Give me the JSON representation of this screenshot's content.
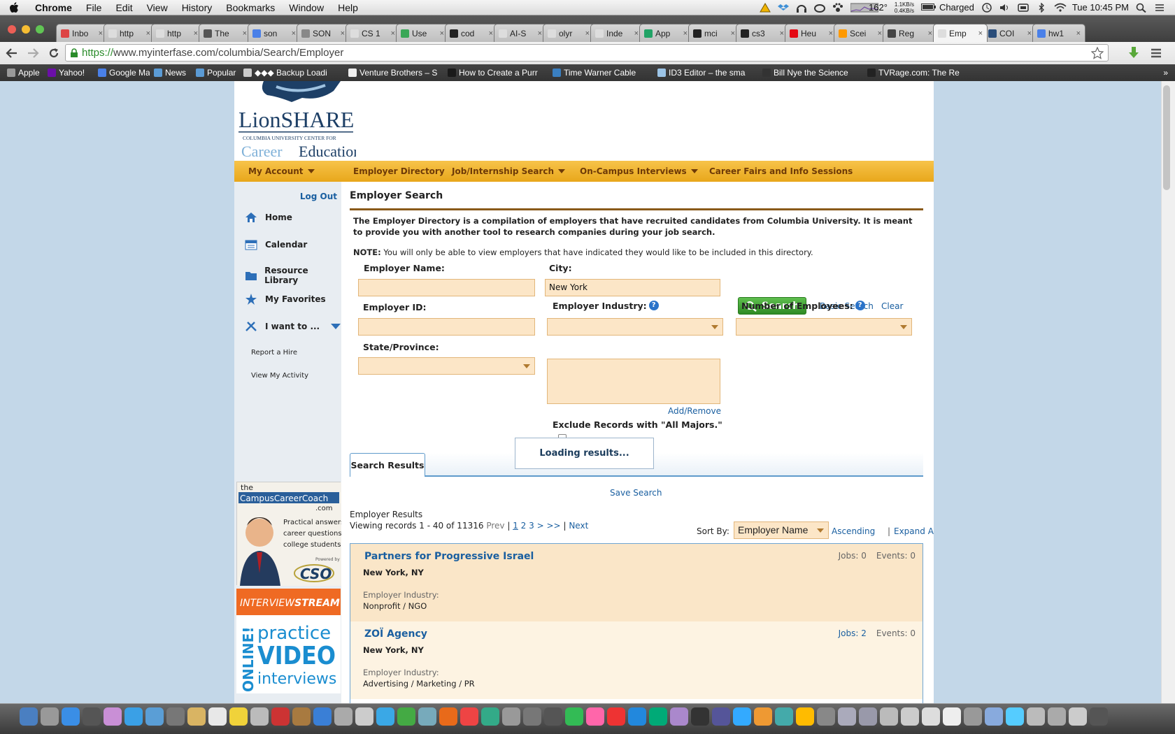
{
  "menubar": {
    "items": [
      "Chrome",
      "File",
      "Edit",
      "View",
      "History",
      "Bookmarks",
      "Window",
      "Help"
    ],
    "temperature": "162°",
    "net_up": "1.1KB/s",
    "net_down": "0.4KB/s",
    "battery": "Charged",
    "clock": "Tue 10:45 PM"
  },
  "tabs": [
    {
      "title": "Inbo",
      "color": "#d44"
    },
    {
      "title": "http",
      "color": "#ddd"
    },
    {
      "title": "http",
      "color": "#ddd"
    },
    {
      "title": "The",
      "color": "#555"
    },
    {
      "title": "son",
      "color": "#4a80e8"
    },
    {
      "title": "SON",
      "color": "#888"
    },
    {
      "title": "CS 1",
      "color": "#ddd"
    },
    {
      "title": "Use",
      "color": "#3aa757"
    },
    {
      "title": "cod",
      "color": "#222"
    },
    {
      "title": "AI-S",
      "color": "#ddd"
    },
    {
      "title": "olyr",
      "color": "#ddd"
    },
    {
      "title": "Inde",
      "color": "#ddd"
    },
    {
      "title": "App",
      "color": "#21a366"
    },
    {
      "title": "mci",
      "color": "#222"
    },
    {
      "title": "cs3",
      "color": "#222"
    },
    {
      "title": "Heu",
      "color": "#e50914"
    },
    {
      "title": "Scei",
      "color": "#f90"
    },
    {
      "title": "Reg",
      "color": "#444"
    },
    {
      "title": "Emp",
      "color": "#ddd"
    },
    {
      "title": "COI",
      "color": "#2a4d7a"
    },
    {
      "title": "hw1",
      "color": "#4a80e8"
    }
  ],
  "address": {
    "scheme": "https://",
    "rest": "www.myinterfase.com/columbia/Search/Employer"
  },
  "bookmarks": [
    {
      "label": "Apple",
      "color": "#999"
    },
    {
      "label": "Yahoo!",
      "color": "#6b0fa8"
    },
    {
      "label": "Google Maps",
      "color": "#4a80e8"
    },
    {
      "label": "News",
      "color": "#5b9bd5"
    },
    {
      "label": "Popular",
      "color": "#5b9bd5"
    },
    {
      "label": "◆◆◆ Backup Loadi",
      "color": "#ccc"
    },
    {
      "label": "Venture Brothers – S",
      "color": "#eee"
    },
    {
      "label": "How to Create a Purr",
      "color": "#1a1a1a"
    },
    {
      "label": "Time Warner Cable",
      "color": "#3a7fc1"
    },
    {
      "label": "ID3 Editor – the sma",
      "color": "#9cc4e6"
    },
    {
      "label": "Bill Nye the Science",
      "color": "#333"
    },
    {
      "label": "TVRage.com: The Re",
      "color": "#222"
    }
  ],
  "site": {
    "logo_line1": "LionSHARE",
    "logo_line2": "COLUMBIA UNIVERSITY CENTER FOR",
    "logo_career": "Career",
    "logo_education": "Education"
  },
  "nav": {
    "my_account": "My Account",
    "employer_directory": "Employer Directory",
    "job_search": "Job/Internship Search",
    "on_campus": "On-Campus Interviews",
    "career_fairs": "Career Fairs and Info Sessions"
  },
  "sidebar": {
    "logout": "Log Out",
    "items": [
      "Home",
      "Calendar",
      "Resource Library",
      "My Favorites",
      "I want to ..."
    ],
    "subitems": [
      "Report a Hire",
      "View My Activity"
    ],
    "ad1": {
      "the": "the",
      "brand": "CampusCareerCoach",
      "com": ".com",
      "tagline1": "Practical answers to",
      "tagline2": "career questions for",
      "tagline3": "college students.",
      "powered": "Powered by",
      "cso": "CSO"
    },
    "ad2": {
      "interview": "INTERVIEW",
      "stream": "STREAM",
      "online": "ONLINE!",
      "practice": "practice",
      "video": "VIDEO",
      "interviews": "interviews"
    }
  },
  "main": {
    "title": "Employer Search",
    "intro": "The Employer Directory is a compilation of employers that have recruited candidates from Columbia University.  It is meant to provide you with another tool to research companies during your job search.",
    "note_label": "NOTE:",
    "note_text": " You will only be able to view employers that have indicated they would like to be included in this directory.",
    "form": {
      "employer_name_label": "Employer Name:",
      "employer_name_value": "",
      "city_label": "City:",
      "city_value": "New York",
      "search_button": "Search",
      "basic_search": "Basic Search",
      "clear": "Clear",
      "employer_id_label": "Employer ID:",
      "industry_label": "Employer Industry:",
      "num_employees_label": "Number of Employees:",
      "state_label": "State/Province:",
      "add_remove": "Add/Remove",
      "exclude_label": "Exclude Records with \"All Majors.\"",
      "help_glyph": "?"
    },
    "loading": "Loading results...",
    "results_tab": "Search Results",
    "save_search": "Save Search",
    "results_heading": "Employer Results",
    "viewing": "Viewing records 1 - 40 of 11316",
    "prev": "Prev",
    "pages": [
      "1",
      "2",
      "3",
      ">",
      ">>"
    ],
    "next": "Next",
    "sort_by_label": "Sort By:",
    "sort_value": "Employer Name",
    "ascending": "Ascending",
    "expand_all": "Expand All",
    "separator": "|",
    "results": [
      {
        "name": "Partners for Progressive Israel",
        "city": "New York, NY",
        "industry_label": "Employer Industry:",
        "industry": "Nonprofit / NGO",
        "jobs": "Jobs: 0",
        "events": "Events: 0",
        "bg": "#fae6c8"
      },
      {
        "name": "ZOÏ Agency",
        "city": "New York, NY",
        "industry_label": "Employer Industry:",
        "industry": "Advertising / Marketing / PR",
        "jobs": "Jobs: 2",
        "events": "Events: 0",
        "bg": "#fdf3e2"
      }
    ]
  },
  "colors": {
    "nav_gold": "#f0b532",
    "link_blue": "#1a5fa0",
    "field_peach": "#fce6c7",
    "search_green": "#3ea531"
  }
}
